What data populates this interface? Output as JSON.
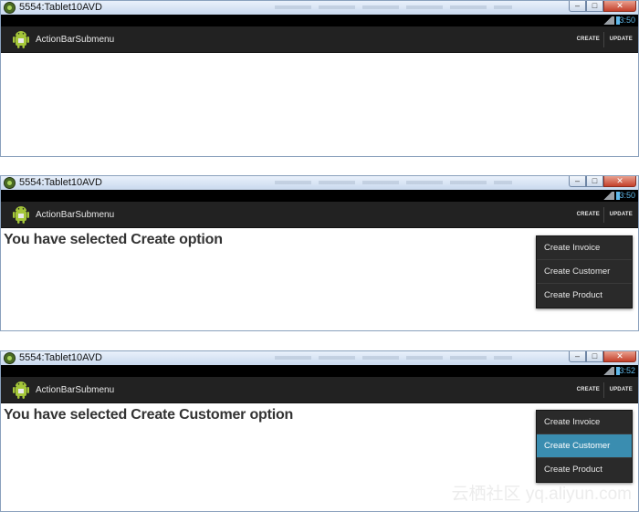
{
  "windows": [
    {
      "title": "5554:Tablet10AVD",
      "clock": "3:50",
      "app_title": "ActionBarSubmenu",
      "actions": {
        "create": "CREATE",
        "update": "UPDATE"
      },
      "message": ""
    },
    {
      "title": "5554:Tablet10AVD",
      "clock": "3:50",
      "app_title": "ActionBarSubmenu",
      "actions": {
        "create": "CREATE",
        "update": "UPDATE"
      },
      "message": "You have selected Create option",
      "submenu": [
        "Create Invoice",
        "Create Customer",
        "Create Product"
      ],
      "selected_index": null
    },
    {
      "title": "5554:Tablet10AVD",
      "clock": "3:52",
      "app_title": "ActionBarSubmenu",
      "actions": {
        "create": "CREATE",
        "update": "UPDATE"
      },
      "message": "You have selected Create Customer option",
      "submenu": [
        "Create Invoice",
        "Create Customer",
        "Create Product"
      ],
      "selected_index": 1
    }
  ],
  "window_controls": {
    "minimize": "–",
    "maximize": "□",
    "close": "✕"
  },
  "colors": {
    "action_bar": "#222222",
    "status_bar": "#000000",
    "clock": "#5fb7e8",
    "submenu_bg": "#2a2a2a",
    "submenu_selected": "#3a8db0",
    "android_green": "#a4c639"
  },
  "icons": [
    "android-logo-icon",
    "emulator-app-icon",
    "signal-icon",
    "battery-icon"
  ],
  "watermark": "云栖社区 yq.aliyun.com"
}
